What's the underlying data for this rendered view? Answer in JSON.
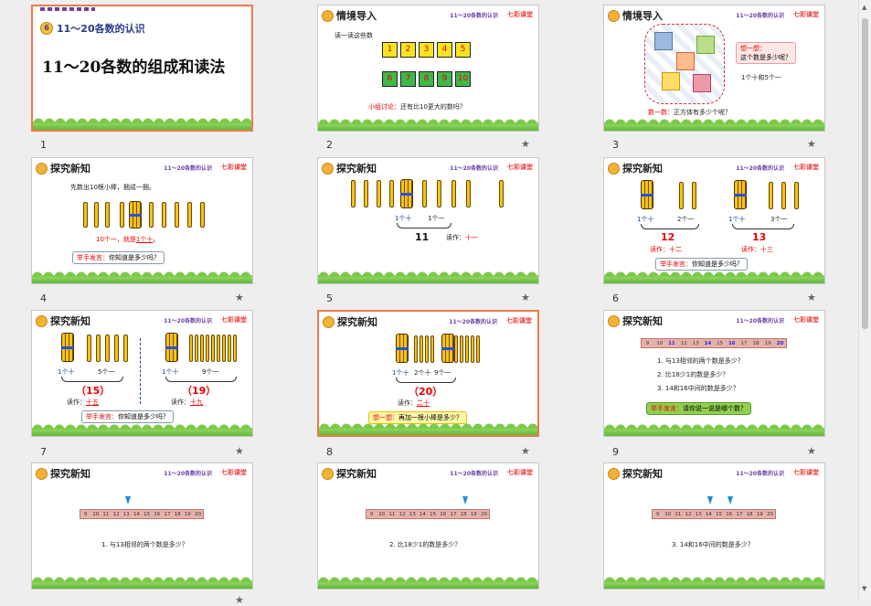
{
  "slides": [
    {
      "num": "1",
      "title": "11～20各数的认识",
      "unit": "6",
      "heading": "11～20各数的组成和读法"
    },
    {
      "num": "2",
      "title": "情境导入",
      "subtitle": "11～20各数的认识",
      "logo": "七彩课堂",
      "prompt": "读一读这些数",
      "row1": [
        "1",
        "2",
        "3",
        "4",
        "5"
      ],
      "row2": [
        "6",
        "7",
        "8",
        "9",
        "10"
      ],
      "question_label": "小组讨论：",
      "question": "还有比10更大的数吗？"
    },
    {
      "num": "3",
      "title": "情境导入",
      "subtitle": "11～20各数的认识",
      "logo": "七彩课堂",
      "think_label": "想一想：",
      "think": "这个数是多少呢？",
      "answer": "1个十和5个一",
      "count_label": "数一数：",
      "count": "正方体有多少个呢？"
    },
    {
      "num": "4",
      "title": "探究新知",
      "subtitle": "11～20各数的认识",
      "logo": "七彩课堂",
      "instr": "先数出10根小棒，捆成一捆。",
      "line1a": "10个一，就是",
      "line1b": "1个十",
      "line1c": "。",
      "tip_label": "举手发言：",
      "tip": "你知道是多少吗？"
    },
    {
      "num": "5",
      "title": "探究新知",
      "subtitle": "11～20各数的认识",
      "logo": "七彩课堂",
      "l1": "1个十",
      "l2": "1个一",
      "value": "11",
      "read_label": "读作：",
      "read": "十一"
    },
    {
      "num": "6",
      "title": "探究新知",
      "subtitle": "11～20各数的认识",
      "logo": "七彩课堂",
      "a1": "1个十",
      "a2": "2个一",
      "av": "12",
      "ar_label": "读作：",
      "ar": "十二",
      "b1": "1个十",
      "b2": "3个一",
      "bv": "13",
      "br_label": "读作：",
      "br": "十三",
      "tip_label": "举手发言：",
      "tip": "你知道是多少吗？"
    },
    {
      "num": "7",
      "title": "探究新知",
      "subtitle": "11～20各数的认识",
      "logo": "七彩课堂",
      "a1": "1个十",
      "a2": "5个一",
      "av": "（15）",
      "ar_label": "读作：",
      "ar": "十五",
      "b1": "1个十",
      "b2": "9个一",
      "bv": "（19）",
      "br_label": "读作：",
      "br": "十九",
      "tip_label": "举手发言：",
      "tip": "你知道是多少吗？"
    },
    {
      "num": "8",
      "title": "探究新知",
      "subtitle": "11～20各数的认识",
      "logo": "七彩课堂",
      "a1": "1个十",
      "a2": "2个十",
      "a3": "9个一",
      "v": "（20）",
      "r_label": "读作：",
      "r": "二十",
      "tip_label": "想一想：",
      "tip": "再加一根小棒是多少？"
    },
    {
      "num": "9",
      "title": "探究新知",
      "subtitle": "11～20各数的认识",
      "logo": "七彩课堂",
      "ruler": [
        "9",
        "10",
        "11",
        "12",
        "13",
        "14",
        "15",
        "16",
        "17",
        "18",
        "19",
        "20"
      ],
      "q1": "1. 与13相邻的两个数是多少？",
      "q2": "2. 比18少1的数是多少？",
      "q3": "3. 14和16中间的数是多少？",
      "tip_label": "举手发言：",
      "tip": "请你说一说是哪个数？"
    },
    {
      "num": "10",
      "title": "探究新知",
      "subtitle": "11～20各数的认识",
      "logo": "七彩课堂",
      "ruler": [
        "9",
        "10",
        "11",
        "12",
        "13",
        "14",
        "15",
        "16",
        "17",
        "18",
        "19",
        "20"
      ],
      "q": "1. 与13相邻的两个数是多少？"
    },
    {
      "num": "11",
      "title": "探究新知",
      "subtitle": "11～20各数的认识",
      "logo": "七彩课堂",
      "ruler": [
        "9",
        "10",
        "11",
        "12",
        "13",
        "14",
        "15",
        "16",
        "17",
        "18",
        "19",
        "20"
      ],
      "q": "2. 比18少1的数是多少？"
    },
    {
      "num": "12",
      "title": "探究新知",
      "subtitle": "11～20各数的认识",
      "logo": "七彩课堂",
      "ruler": [
        "9",
        "10",
        "11",
        "12",
        "13",
        "14",
        "15",
        "16",
        "17",
        "18",
        "19",
        "20"
      ],
      "q": "3. 14和16中间的数是多少？"
    }
  ],
  "colors": {
    "selected_border": "#f07a4a",
    "stick": "#f5c21a",
    "grass": "#5fb83a",
    "purple": "#6a3fa8"
  }
}
